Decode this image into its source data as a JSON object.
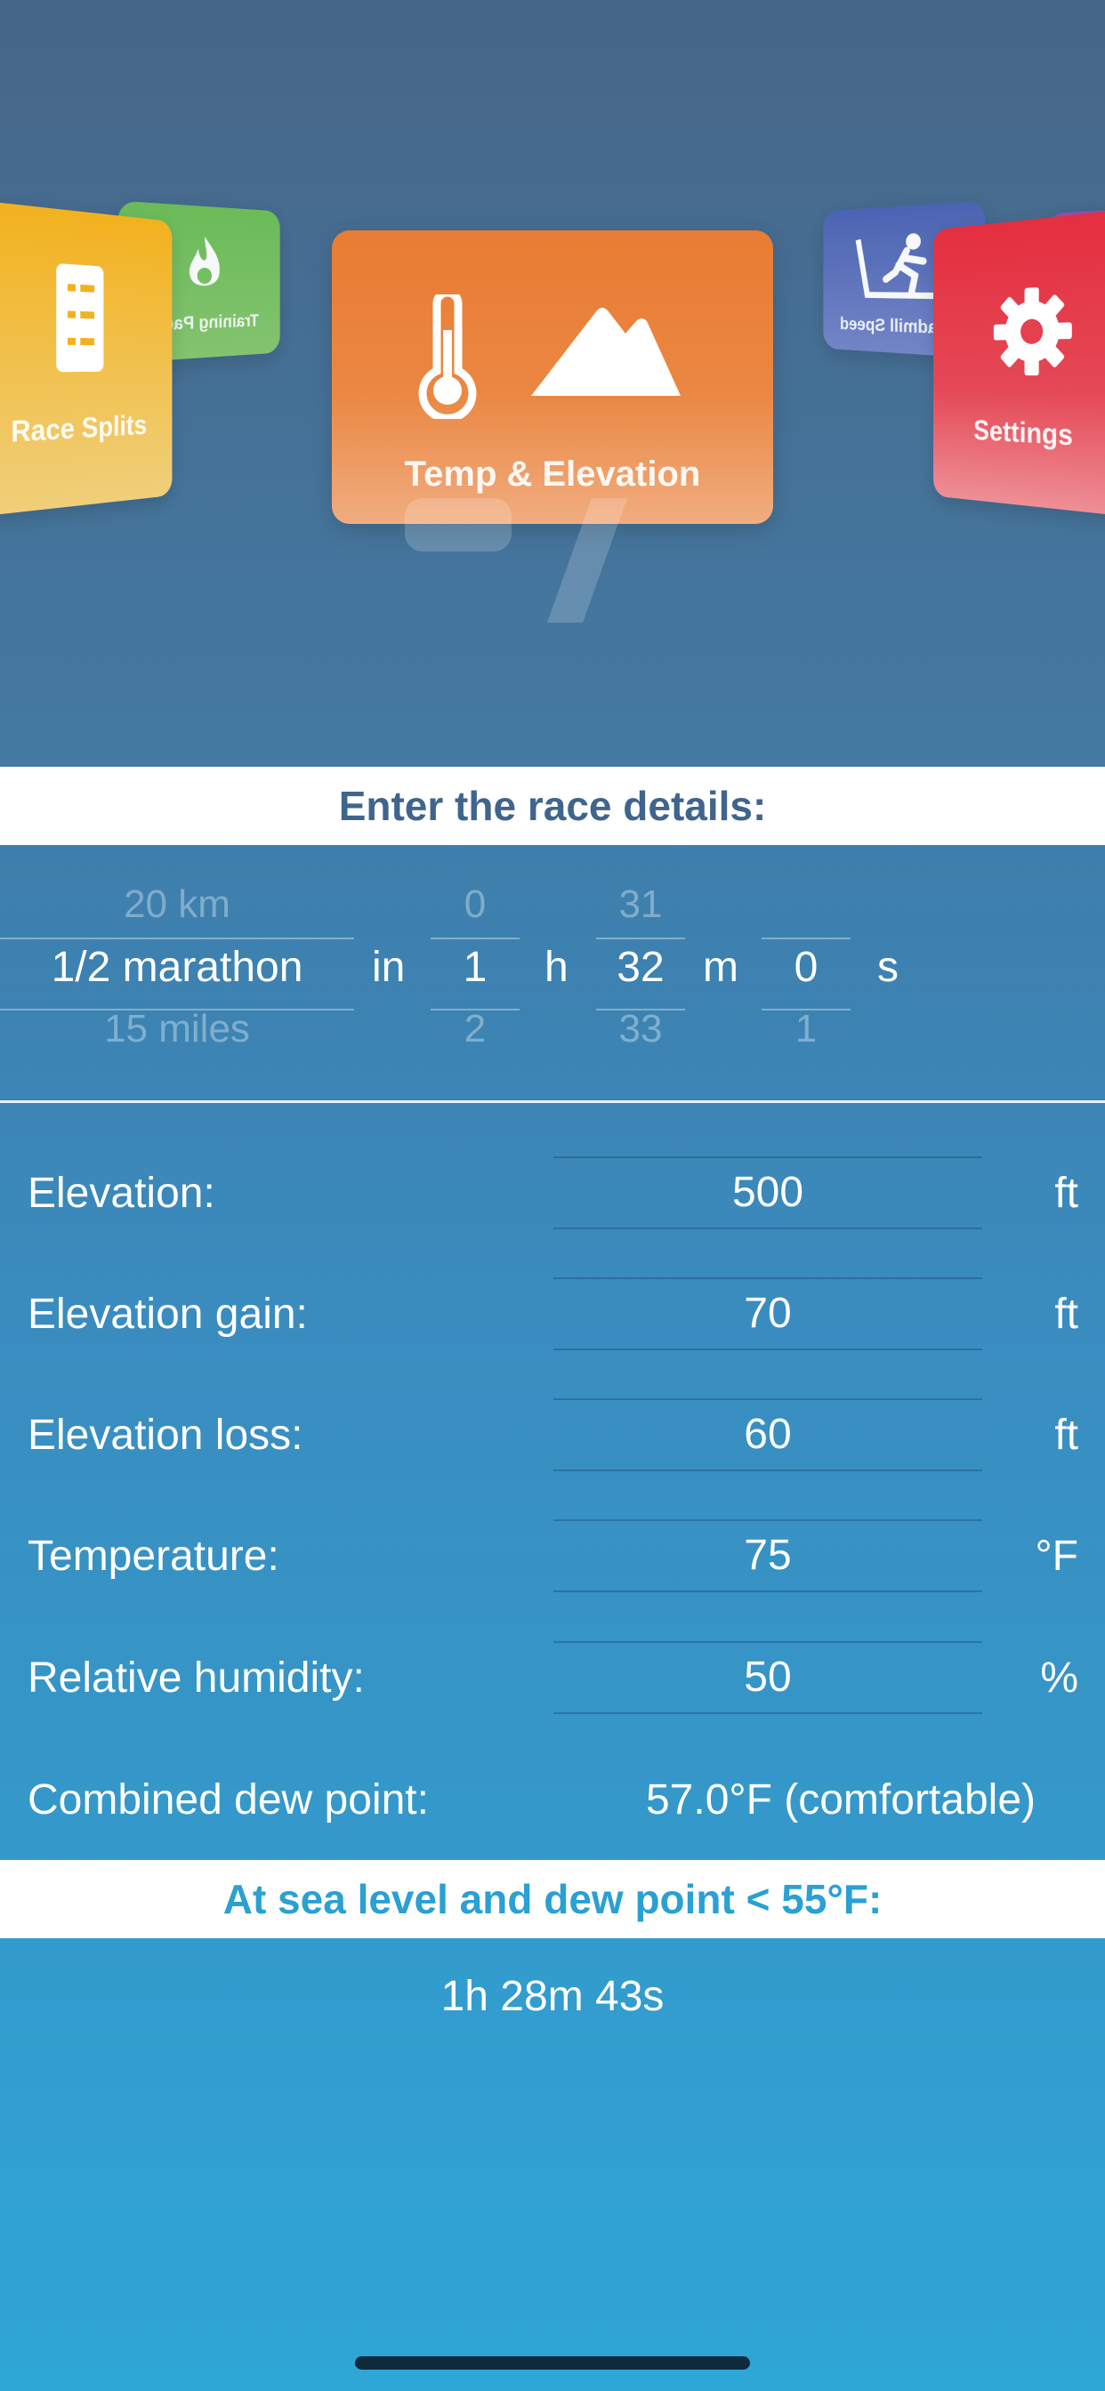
{
  "carousel": {
    "cards": [
      {
        "id": "race-splits",
        "label": "Race Splits"
      },
      {
        "id": "training-paces",
        "label": "Training Paces"
      },
      {
        "id": "temp-elevation",
        "label": "Temp & Elevation"
      },
      {
        "id": "treadmill-speed",
        "label": "Treadmill Speed"
      },
      {
        "id": "settings",
        "label": "Settings"
      }
    ]
  },
  "header": {
    "race_details_title": "Enter the race details:"
  },
  "picker": {
    "distance": {
      "prev": "20 km",
      "current": "1/2 marathon",
      "next": "15 miles"
    },
    "connector": "in",
    "hours": {
      "prev": "0",
      "current": "1",
      "next": "2",
      "unit": "h"
    },
    "minutes": {
      "prev": "31",
      "current": "32",
      "next": "33",
      "unit": "m"
    },
    "seconds": {
      "prev": "",
      "current": "0",
      "next": "1",
      "unit": "s"
    }
  },
  "form": {
    "elevation": {
      "label": "Elevation:",
      "value": "500",
      "unit": "ft"
    },
    "elevation_gain": {
      "label": "Elevation gain:",
      "value": "70",
      "unit": "ft"
    },
    "elevation_loss": {
      "label": "Elevation loss:",
      "value": "60",
      "unit": "ft"
    },
    "temperature": {
      "label": "Temperature:",
      "value": "75",
      "unit": "°F"
    },
    "humidity": {
      "label": "Relative humidity:",
      "value": "50",
      "unit": "%"
    },
    "dew_point": {
      "label": "Combined dew point:",
      "value": "57.0°F (comfortable)"
    }
  },
  "result": {
    "title": "At sea level and dew point < 55°F:",
    "value": "1h 28m 43s"
  },
  "colors": {
    "accent_text": "#40658d",
    "result_text": "#2aa0d3",
    "card_orange": "#e97c33",
    "card_red": "#e42f3f",
    "card_yellow": "#f2b21f",
    "card_green": "#6cbf55",
    "card_blue": "#4b62b4"
  }
}
